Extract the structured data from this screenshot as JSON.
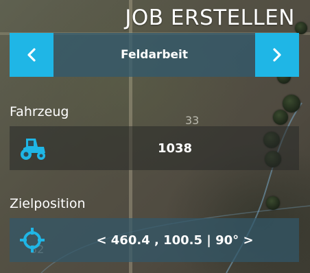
{
  "panel": {
    "title": "JOB ERSTELLEN",
    "job_type": {
      "prev_icon": "chevron-left-icon",
      "next_icon": "chevron-right-icon",
      "value": "Feldarbeit"
    },
    "vehicle": {
      "label": "Fahrzeug",
      "icon": "tractor-icon",
      "value": "1038"
    },
    "target": {
      "label": "Zielposition",
      "icon": "crosshair-icon",
      "value": "< 460.4 , 100.5 | 90° >"
    }
  },
  "map": {
    "field_labels": [
      "33",
      "32"
    ]
  },
  "colors": {
    "accent": "#1fb6e6",
    "selector_bg": "#325a6e",
    "row_bg": "#2a2c2a"
  }
}
